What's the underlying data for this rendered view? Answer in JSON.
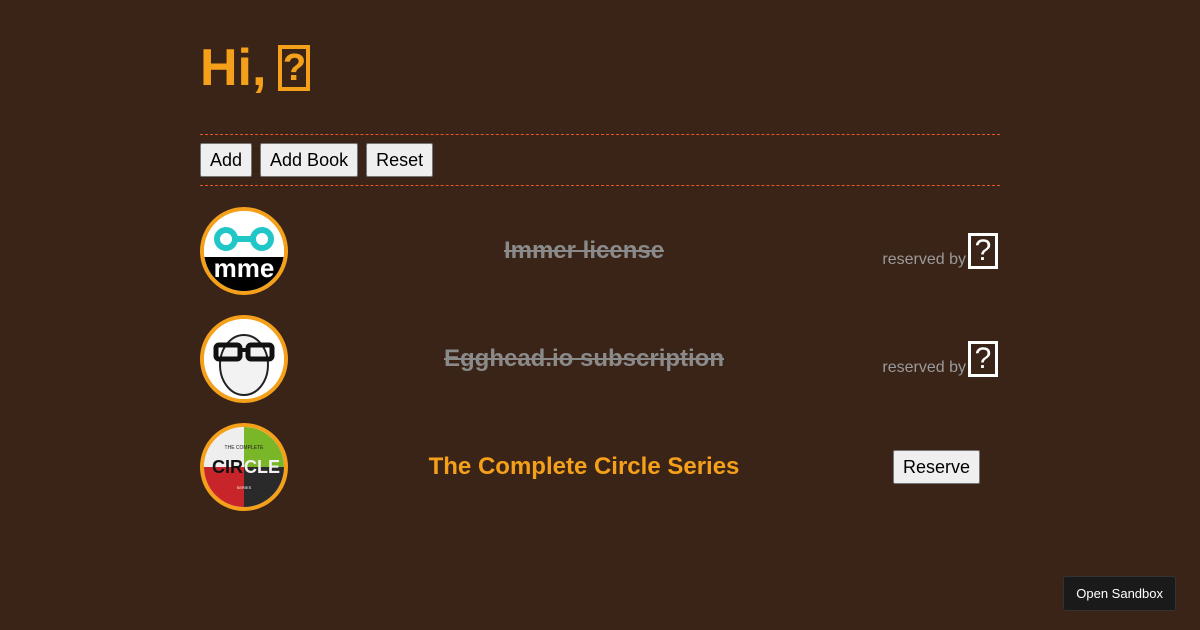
{
  "header": {
    "greeting": "Hi,",
    "user_glyph": "?"
  },
  "toolbar": {
    "add_label": "Add",
    "add_book_label": "Add Book",
    "reset_label": "Reset"
  },
  "gifts": [
    {
      "title": "Immer license",
      "reserved": true,
      "status_text": "reserved by",
      "reserver_glyph": "?",
      "image_icon": "immer-logo-icon"
    },
    {
      "title": "Egghead.io subscription",
      "reserved": true,
      "status_text": "reserved by",
      "reserver_glyph": "?",
      "image_icon": "egghead-logo-icon"
    },
    {
      "title": "The Complete Circle Series",
      "reserved": false,
      "reserve_label": "Reserve",
      "image_icon": "circle-series-cover-icon",
      "cover_text_top": "THE COMPLETE",
      "cover_text_main_left": "CIR",
      "cover_text_main_right": "CLE",
      "cover_text_bottom": "SERIES"
    }
  ],
  "footer": {
    "sandbox_label": "Open Sandbox"
  },
  "colors": {
    "background": "#3a2417",
    "accent": "#f5a01a",
    "divider": "#e05a28",
    "muted": "#8a8a8a"
  }
}
